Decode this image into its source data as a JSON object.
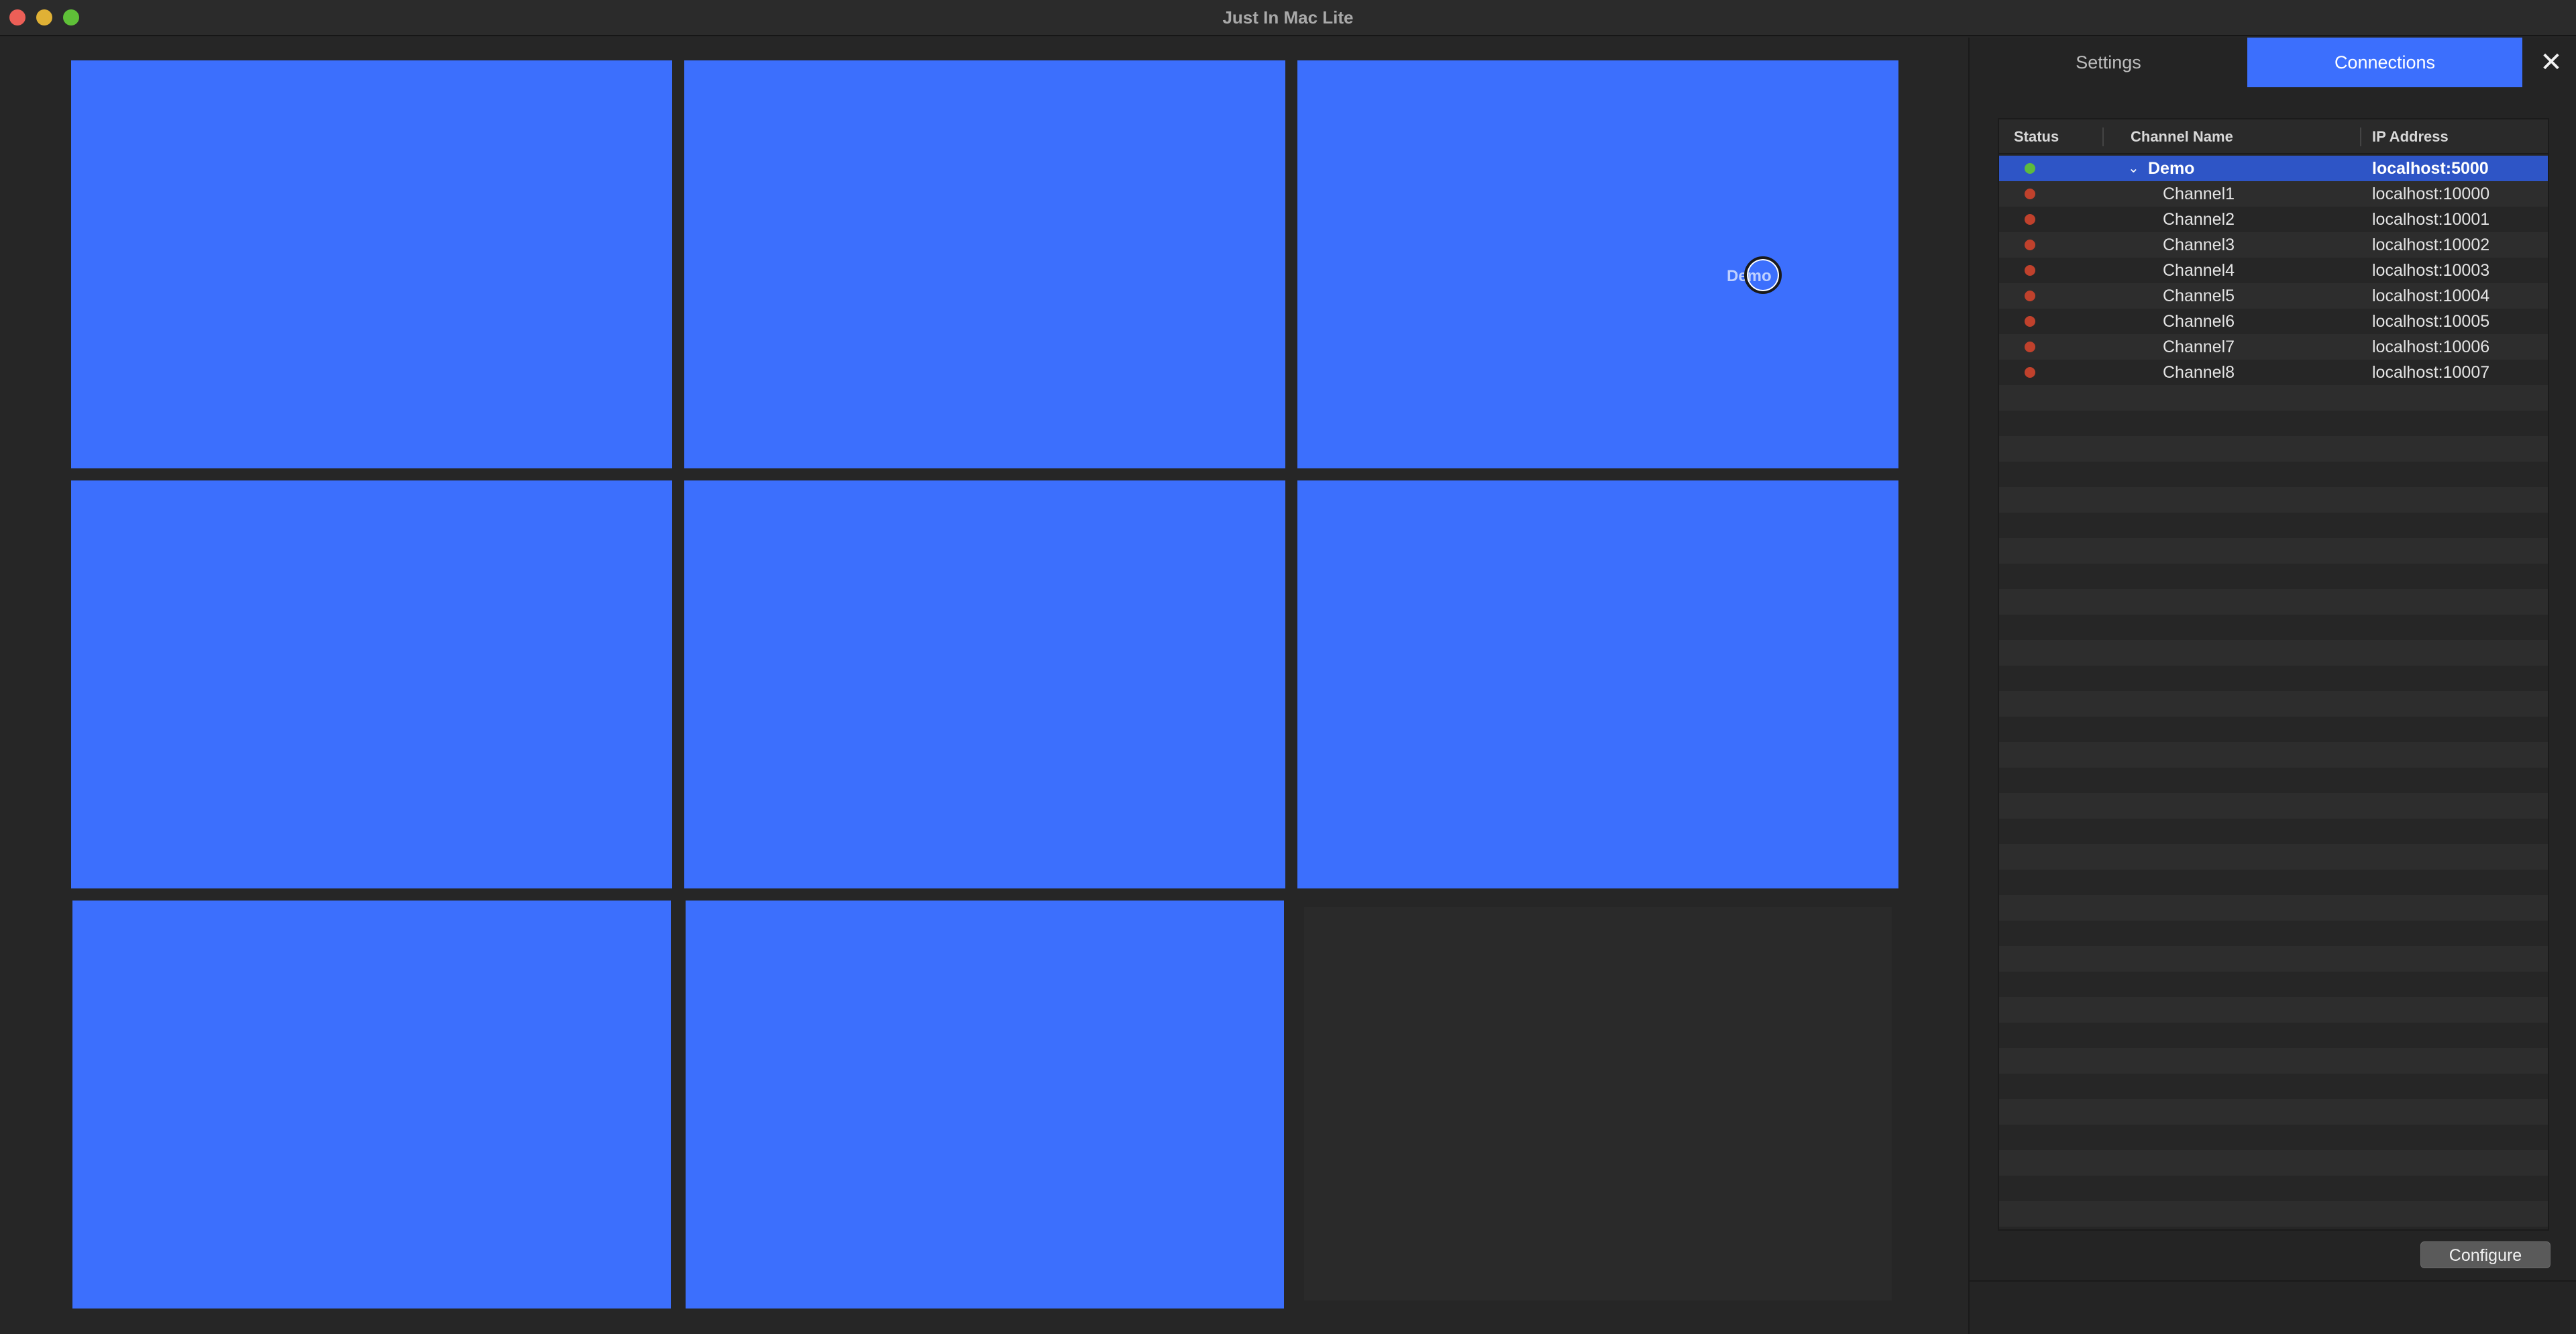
{
  "window": {
    "title": "Just In Mac Lite"
  },
  "grid": {
    "tile_label_overlay": "Demo"
  },
  "panel": {
    "tabs": [
      {
        "label": "Settings",
        "active": false
      },
      {
        "label": "Connections",
        "active": true
      }
    ],
    "close_label": "✕",
    "table": {
      "columns": [
        "Status",
        "Channel Name",
        "IP Address"
      ],
      "rows": [
        {
          "status": "green",
          "name": "Demo",
          "ip": "localhost:5000",
          "expanded": true,
          "selected": true
        },
        {
          "status": "red",
          "name": "Channel1",
          "ip": "localhost:10000"
        },
        {
          "status": "red",
          "name": "Channel2",
          "ip": "localhost:10001"
        },
        {
          "status": "red",
          "name": "Channel3",
          "ip": "localhost:10002"
        },
        {
          "status": "red",
          "name": "Channel4",
          "ip": "localhost:10003"
        },
        {
          "status": "red",
          "name": "Channel5",
          "ip": "localhost:10004"
        },
        {
          "status": "red",
          "name": "Channel6",
          "ip": "localhost:10005"
        },
        {
          "status": "red",
          "name": "Channel7",
          "ip": "localhost:10006"
        },
        {
          "status": "red",
          "name": "Channel8",
          "ip": "localhost:10007"
        }
      ]
    },
    "configure_label": "Configure"
  },
  "colors": {
    "accent": "#3c6ffd",
    "status_green": "#5dbb3d",
    "status_red": "#c0412c"
  }
}
